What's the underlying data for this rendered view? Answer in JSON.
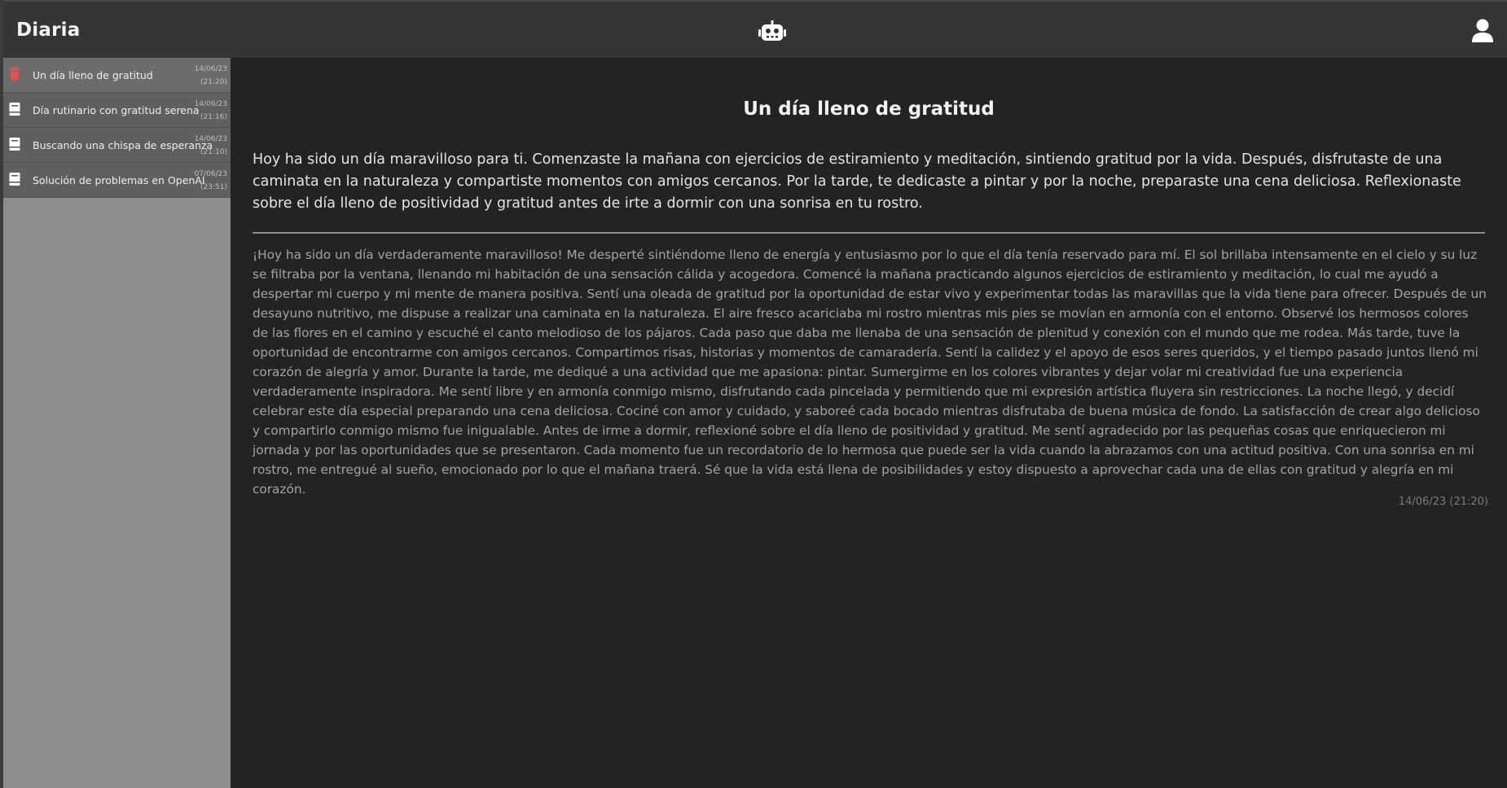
{
  "header": {
    "app_title": "Diaria",
    "robot_icon": "robot-icon",
    "user_icon": "user-icon"
  },
  "sidebar": {
    "items": [
      {
        "title": "Un día lleno de gratitud",
        "date": "14/06/23",
        "time": "(21:20)",
        "icon": "trash-icon",
        "active": true
      },
      {
        "title": "Día rutinario con gratitud serena",
        "date": "14/06/23",
        "time": "(21:16)",
        "icon": "book-icon",
        "active": false
      },
      {
        "title": "Buscando una chispa de esperanza",
        "date": "14/06/23",
        "time": "(21:10)",
        "icon": "book-icon",
        "active": false
      },
      {
        "title": "Solución de problemas en OpenAI",
        "date": "07/06/23",
        "time": "(23:51)",
        "icon": "book-icon",
        "active": false
      }
    ]
  },
  "main": {
    "title": "Un día lleno de gratitud",
    "summary": "Hoy ha sido un día maravilloso para ti. Comenzaste la mañana con ejercicios de estiramiento y meditación, sintiendo gratitud por la vida. Después, disfrutaste de una caminata en la naturaleza y compartiste momentos con amigos cercanos. Por la tarde, te dedicaste a pintar y por la noche, preparaste una cena deliciosa. Reflexionaste sobre el día lleno de positividad y gratitud antes de irte a dormir con una sonrisa en tu rostro.",
    "full_text": "¡Hoy ha sido un día verdaderamente maravilloso! Me desperté sintiéndome lleno de energía y entusiasmo por lo que el día tenía reservado para mí. El sol brillaba intensamente en el cielo y su luz se filtraba por la ventana, llenando mi habitación de una sensación cálida y acogedora. Comencé la mañana practicando algunos ejercicios de estiramiento y meditación, lo cual me ayudó a despertar mi cuerpo y mi mente de manera positiva. Sentí una oleada de gratitud por la oportunidad de estar vivo y experimentar todas las maravillas que la vida tiene para ofrecer. Después de un desayuno nutritivo, me dispuse a realizar una caminata en la naturaleza. El aire fresco acariciaba mi rostro mientras mis pies se movían en armonía con el entorno. Observé los hermosos colores de las flores en el camino y escuché el canto melodioso de los pájaros. Cada paso que daba me llenaba de una sensación de plenitud y conexión con el mundo que me rodea. Más tarde, tuve la oportunidad de encontrarme con amigos cercanos. Compartimos risas, historias y momentos de camaradería. Sentí la calidez y el apoyo de esos seres queridos, y el tiempo pasado juntos llenó mi corazón de alegría y amor. Durante la tarde, me dediqué a una actividad que me apasiona: pintar. Sumergirme en los colores vibrantes y dejar volar mi creatividad fue una experiencia verdaderamente inspiradora. Me sentí libre y en armonía conmigo mismo, disfrutando cada pincelada y permitiendo que mi expresión artística fluyera sin restricciones. La noche llegó, y decidí celebrar este día especial preparando una cena deliciosa. Cociné con amor y cuidado, y saboreé cada bocado mientras disfrutaba de buena música de fondo. La satisfacción de crear algo delicioso y compartirlo conmigo mismo fue inigualable. Antes de irme a dormir, reflexioné sobre el día lleno de positividad y gratitud. Me sentí agradecido por las pequeñas cosas que enriquecieron mi jornada y por las oportunidades que se presentaron. Cada momento fue un recordatorio de lo hermosa que puede ser la vida cuando la abrazamos con una actitud positiva. Con una sonrisa en mi rostro, me entregué al sueño, emocionado por lo que el mañana traerá. Sé que la vida está llena de posibilidades y estoy dispuesto a aprovechar cada una de ellas con gratitud y alegría en mi corazón.",
    "timestamp": "14/06/23 (21:20)"
  },
  "colors": {
    "header_bg": "#353535",
    "sidebar_bg": "#8e8e8e",
    "sidebar_item_bg": "#5f5f5f",
    "main_bg": "#232323",
    "delete_accent": "#d9534f"
  }
}
